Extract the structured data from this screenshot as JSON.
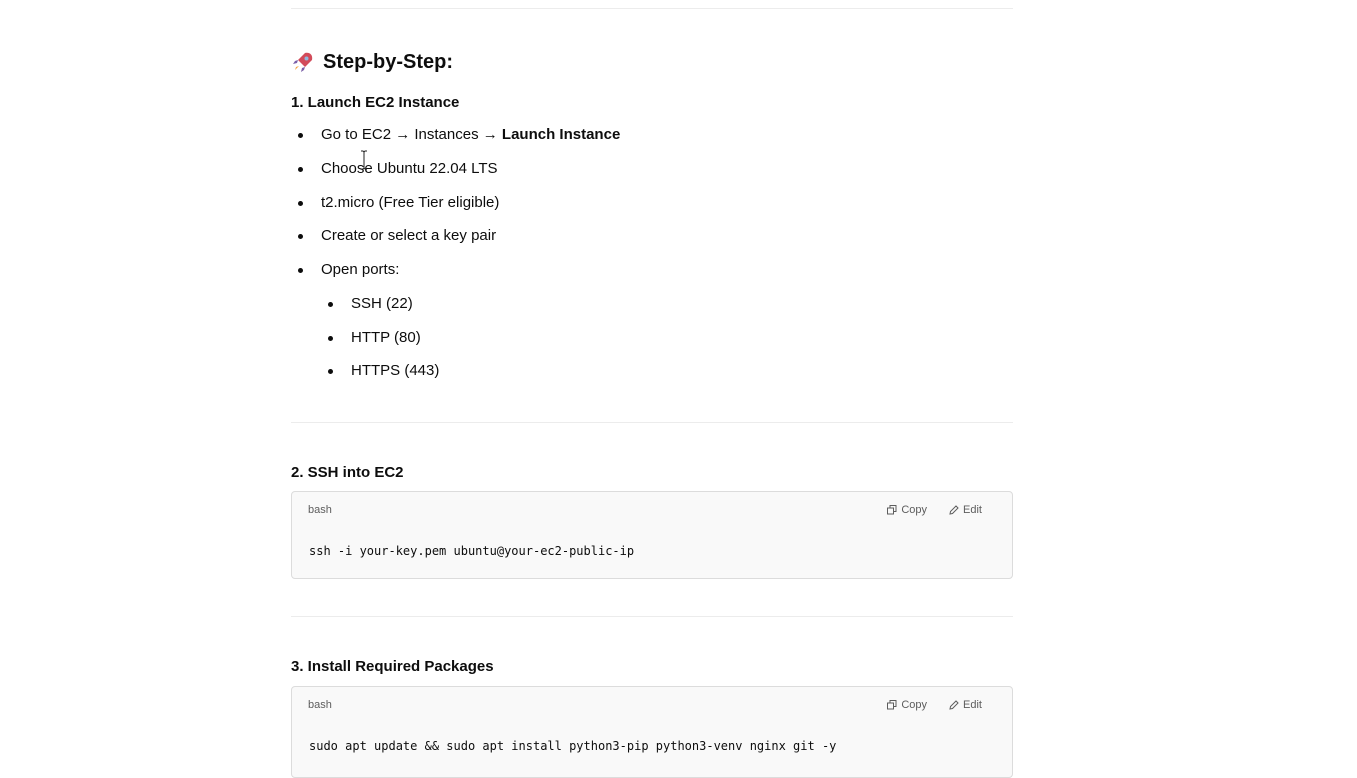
{
  "section_title": "Step-by-Step:",
  "section_icon": "rocket-icon",
  "steps": [
    {
      "heading": "1. Launch EC2 Instance",
      "items": [
        {
          "prefix": "Go to EC2 → Instances → ",
          "bold": "Launch Instance"
        },
        {
          "text": "Choose Ubuntu 22.04 LTS"
        },
        {
          "text": "t2.micro (Free Tier eligible)"
        },
        {
          "text": "Create or select a key pair"
        },
        {
          "text": "Open ports:"
        }
      ],
      "subitems": [
        "SSH (22)",
        "HTTP (80)",
        "HTTPS (443)"
      ]
    },
    {
      "heading": "2. SSH into EC2",
      "code": {
        "lang": "bash",
        "copy_label": "Copy",
        "edit_label": "Edit",
        "content": "ssh -i your-key.pem ubuntu@your-ec2-public-ip"
      }
    },
    {
      "heading": "3. Install Required Packages",
      "code": {
        "lang": "bash",
        "copy_label": "Copy",
        "edit_label": "Edit",
        "content": "sudo apt update && sudo apt install python3-pip python3-venv nginx git -y"
      }
    }
  ],
  "colors": {
    "text": "#0d0d0d",
    "muted": "#5d5d5d",
    "code_bg": "#f9f9f9",
    "border": "#dcdcdc",
    "divider": "#ececec"
  }
}
